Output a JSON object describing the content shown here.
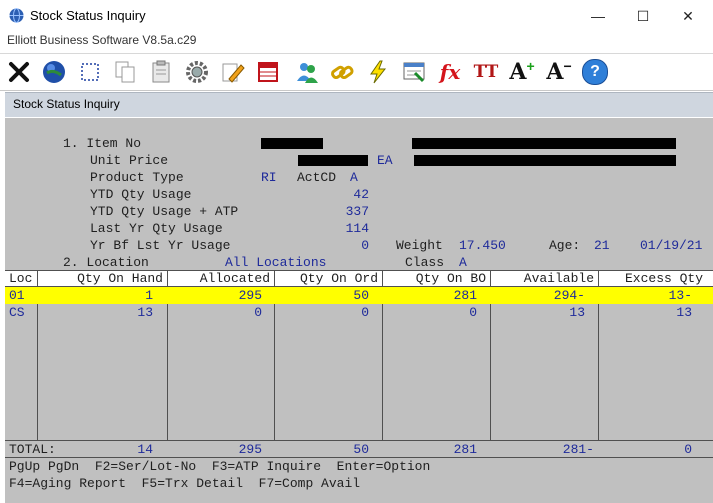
{
  "window": {
    "title": "Stock Status Inquiry",
    "subtitle": "Elliott Business Software V8.5a.c29",
    "minimize_glyph": "—",
    "maximize_glyph": "☐",
    "close_glyph": "✕"
  },
  "toolbar": {
    "icons": [
      "exit-x-icon",
      "globe-icon",
      "select-icon",
      "copy-icon",
      "paste-icon",
      "settings-icon",
      "edit-icon",
      "spreadsheet-icon",
      "users-icon",
      "link-icon",
      "lightning-icon",
      "report-icon",
      "fx-icon",
      "font-size-icon",
      "increase-font-icon",
      "decrease-font-icon",
      "help-icon"
    ],
    "fx_label": "fx",
    "tt_label": "TT",
    "a_plus": "A",
    "a_minus": "A",
    "help_label": "?"
  },
  "screen": {
    "title": "Stock Status Inquiry",
    "item_no_label": "1. Item No",
    "unit_price_label": "Unit Price",
    "unit": "EA",
    "product_type_label": "Product Type",
    "product_type": "RI",
    "actcd_label": "ActCD",
    "actcd": "A",
    "ytd_qty_label": "YTD Qty Usage",
    "ytd_qty": "42",
    "ytd_atp_label": "YTD Qty Usage + ATP",
    "ytd_atp": "337",
    "last_yr_label": "Last Yr Qty Usage",
    "last_yr": "114",
    "yr_bf_label": "Yr Bf Lst Yr Usage",
    "yr_bf": "0",
    "weight_label": "Weight",
    "weight": "17.450",
    "age_label": "Age:",
    "age": "21",
    "date": "01/19/21",
    "location_label": "2. Location",
    "location": "All Locations",
    "class_label": "Class",
    "class_value": "A"
  },
  "table": {
    "headers": [
      "Loc",
      "Qty On Hand",
      "Allocated",
      "Qty On Ord",
      "Qty On BO",
      "Available",
      "Excess Qty"
    ],
    "rows": [
      [
        "01",
        "1",
        "295",
        "50",
        "281",
        "294-",
        "13-"
      ],
      [
        "CS",
        "13",
        "0",
        "0",
        "0",
        "13",
        "13"
      ]
    ],
    "total_label": "TOTAL:",
    "totals": [
      "14",
      "295",
      "50",
      "281",
      "281-",
      "0"
    ]
  },
  "footer": {
    "line1": "PgUp PgDn  F2=Ser/Lot-No  F3=ATP Inquire  Enter=Option",
    "line2": "F4=Aging Report  F5=Trx Detail  F7=Comp Avail"
  }
}
